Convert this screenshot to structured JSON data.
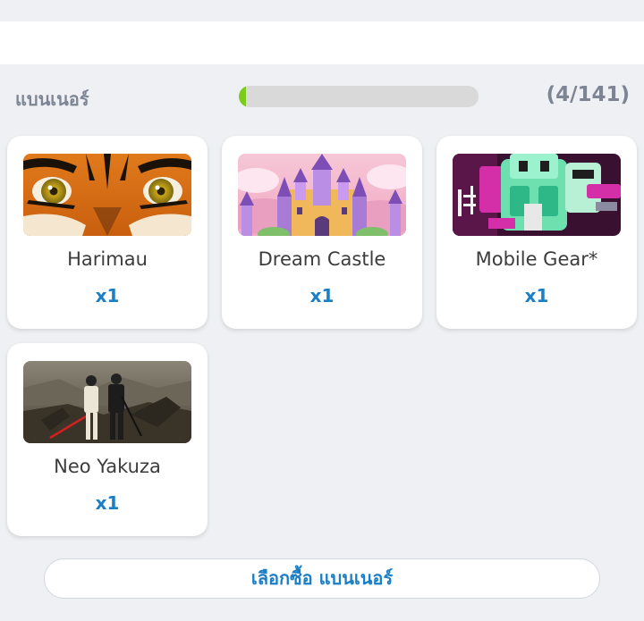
{
  "section": {
    "title": "แบนเนอร์",
    "progress_fraction": 0.0284,
    "progress_label": "(4/141)",
    "progress_color": "#7ccd1b"
  },
  "banners": [
    {
      "name": "Harimau",
      "qty": "x1",
      "image": "tiger-eyes"
    },
    {
      "name": "Dream Castle",
      "qty": "x1",
      "image": "pink-castle"
    },
    {
      "name": "Mobile Gear*",
      "qty": "x1",
      "image": "green-mecha"
    },
    {
      "name": "Neo Yakuza",
      "qty": "x1",
      "image": "yakuza-duo"
    }
  ],
  "buy_button_label": "เลือกซื้อ แบนเนอร์",
  "colors": {
    "accent": "#1c7fc5",
    "muted": "#7d8595",
    "background": "#eff0f3"
  }
}
